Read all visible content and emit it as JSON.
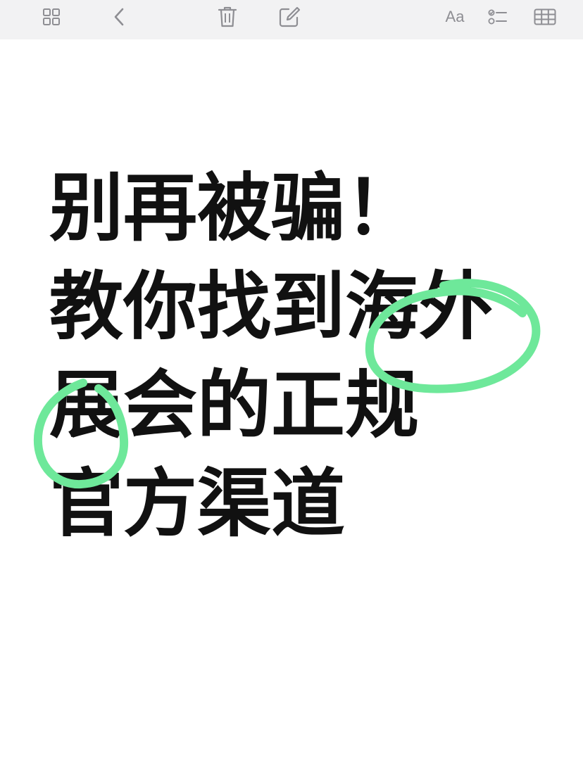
{
  "toolbar": {
    "buttons": [
      {
        "id": "grid",
        "icon": "grid-icon"
      },
      {
        "id": "back",
        "icon": "chevron-left-icon"
      },
      {
        "id": "delete",
        "icon": "trash-icon"
      },
      {
        "id": "compose",
        "icon": "compose-icon"
      },
      {
        "id": "format",
        "icon": "text-format-icon",
        "label": "Aa"
      },
      {
        "id": "checklist",
        "icon": "checklist-icon"
      },
      {
        "id": "table",
        "icon": "table-icon"
      }
    ],
    "background": "#f2f2f3",
    "icon_color": "#8e8e93"
  },
  "note": {
    "lines": [
      "别再被骗！",
      "教你找到海外",
      "展会的正规",
      "官方渠道"
    ],
    "text_color": "#111111",
    "highlight_color": "#6ee89a"
  }
}
